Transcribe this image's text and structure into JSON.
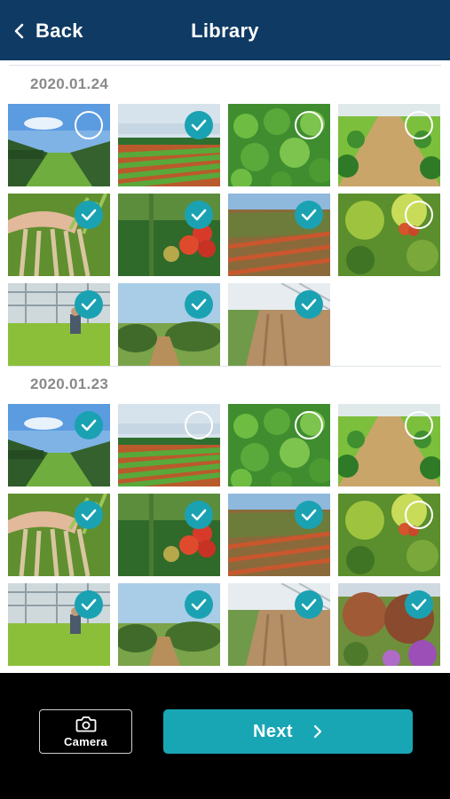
{
  "header": {
    "back_label": "Back",
    "title": "Library"
  },
  "colors": {
    "header_bg": "#0f3a63",
    "accent": "#18a6b4",
    "check_on": "#1aa2b3"
  },
  "sections": [
    {
      "date": "2020.01.24",
      "photos": [
        {
          "scene": "vineyard-rows",
          "selected": false
        },
        {
          "scene": "lettuce-field-stripes",
          "selected": true
        },
        {
          "scene": "lettuce-closeup",
          "selected": false
        },
        {
          "scene": "greenhouse-rows",
          "selected": false
        },
        {
          "scene": "hand-with-roots",
          "selected": true
        },
        {
          "scene": "tomatoes-on-vine",
          "selected": true
        },
        {
          "scene": "sorghum-field",
          "selected": true
        },
        {
          "scene": "leafy-tomato",
          "selected": false
        },
        {
          "scene": "greenhouse-worker",
          "selected": true
        },
        {
          "scene": "shrub-rows",
          "selected": true
        },
        {
          "scene": "tilled-soil",
          "selected": true
        }
      ]
    },
    {
      "date": "2020.01.23",
      "photos": [
        {
          "scene": "vineyard-rows",
          "selected": true
        },
        {
          "scene": "lettuce-field-stripes",
          "selected": false
        },
        {
          "scene": "lettuce-closeup",
          "selected": false
        },
        {
          "scene": "greenhouse-rows",
          "selected": false
        },
        {
          "scene": "hand-with-roots",
          "selected": true
        },
        {
          "scene": "tomatoes-on-vine",
          "selected": true
        },
        {
          "scene": "sorghum-field",
          "selected": true
        },
        {
          "scene": "leafy-tomato",
          "selected": false
        },
        {
          "scene": "greenhouse-worker",
          "selected": true
        },
        {
          "scene": "shrub-rows",
          "selected": true
        },
        {
          "scene": "tilled-soil",
          "selected": true
        },
        {
          "scene": "flowering-shrubs",
          "selected": true
        }
      ]
    }
  ],
  "footer": {
    "camera_label": "Camera",
    "next_label": "Next"
  },
  "icons": {
    "back": "chevron-left-icon",
    "camera": "camera-icon",
    "next": "chevron-right-icon",
    "selected": "checkmark-icon",
    "unselected": "empty-circle-icon"
  }
}
